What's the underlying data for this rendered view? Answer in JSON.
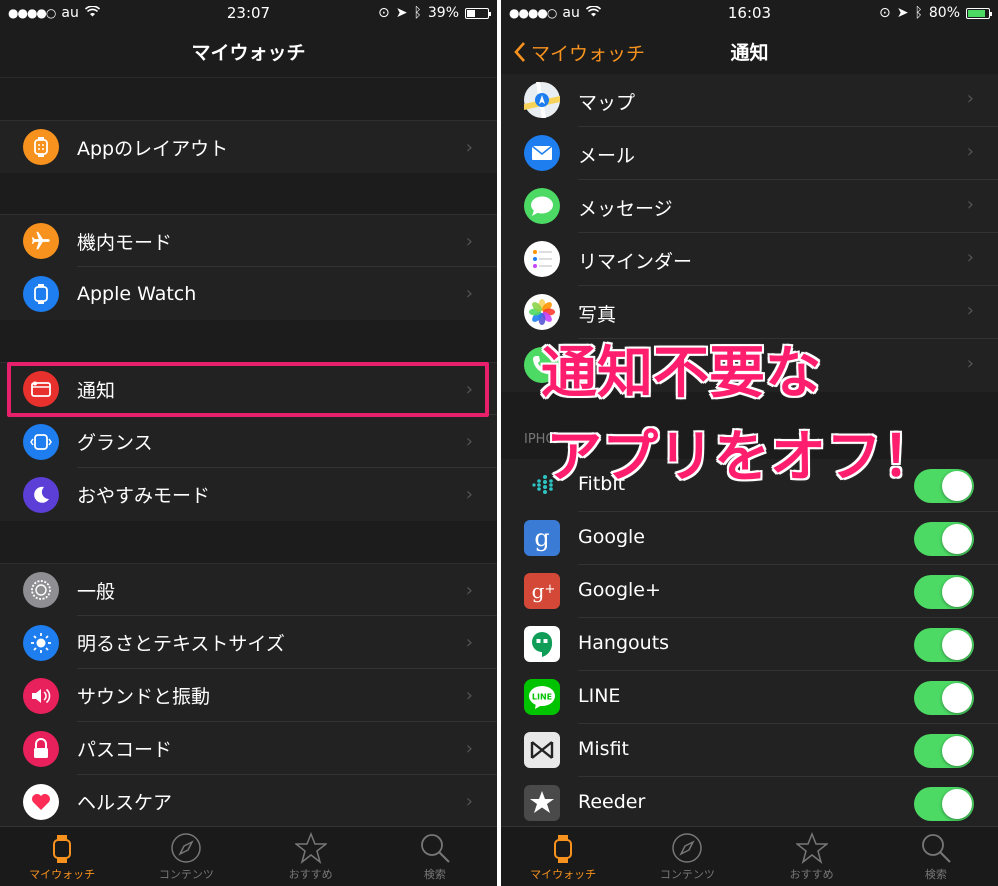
{
  "left": {
    "status": {
      "carrier": "au",
      "time": "23:07",
      "battery": "39%",
      "battery_level": 0.39
    },
    "nav": {
      "title": "マイウォッチ"
    },
    "items": [
      {
        "label": "Appのレイアウト",
        "icon": "app-layout-icon",
        "color": "#f7921e"
      },
      {
        "label": "機内モード",
        "icon": "airplane-icon",
        "color": "#f7921e"
      },
      {
        "label": "Apple Watch",
        "icon": "watch-icon",
        "color": "#1e7ef0"
      },
      {
        "label": "通知",
        "icon": "notification-icon",
        "color": "#e8302c"
      },
      {
        "label": "グランス",
        "icon": "glance-icon",
        "color": "#1e7ef0"
      },
      {
        "label": "おやすみモード",
        "icon": "moon-icon",
        "color": "#5b3fd6"
      },
      {
        "label": "一般",
        "icon": "gear-icon",
        "color": "#8e8e93"
      },
      {
        "label": "明るさとテキストサイズ",
        "icon": "sun-icon",
        "color": "#1e7ef0"
      },
      {
        "label": "サウンドと振動",
        "icon": "speaker-icon",
        "color": "#e8205c"
      },
      {
        "label": "パスコード",
        "icon": "lock-icon",
        "color": "#e8205c"
      },
      {
        "label": "ヘルスケア",
        "icon": "heart-icon",
        "color": "#ffffff"
      }
    ],
    "tabs": [
      {
        "label": "マイウォッチ",
        "icon": "watch-tab-icon"
      },
      {
        "label": "コンテンツ",
        "icon": "compass-icon"
      },
      {
        "label": "おすすめ",
        "icon": "star-icon"
      },
      {
        "label": "検索",
        "icon": "search-icon"
      }
    ]
  },
  "right": {
    "status": {
      "carrier": "au",
      "time": "16:03",
      "battery": "80%",
      "battery_level": 0.8
    },
    "nav": {
      "title": "通知",
      "back_label": "マイウォッチ"
    },
    "mirror_items": [
      {
        "label": "マップ",
        "icon": "maps-icon"
      },
      {
        "label": "メール",
        "icon": "mail-icon"
      },
      {
        "label": "メッセージ",
        "icon": "messages-icon"
      },
      {
        "label": "リマインダー",
        "icon": "reminders-icon"
      },
      {
        "label": "写真",
        "icon": "photos-icon"
      },
      {
        "label": "",
        "icon": "phone-icon"
      }
    ],
    "section_header": "IPHO",
    "toggle_items": [
      {
        "label": "Fitbit",
        "icon": "fitbit-icon",
        "on": true
      },
      {
        "label": "Google",
        "icon": "google-icon",
        "on": true
      },
      {
        "label": "Google+",
        "icon": "google-plus-icon",
        "on": true
      },
      {
        "label": "Hangouts",
        "icon": "hangouts-icon",
        "on": true
      },
      {
        "label": "LINE",
        "icon": "line-icon",
        "on": true
      },
      {
        "label": "Misfit",
        "icon": "misfit-icon",
        "on": true
      },
      {
        "label": "Reeder",
        "icon": "reeder-icon",
        "on": true
      }
    ],
    "overlay": {
      "line1": "通知不要な",
      "line2": "アプリをオフ！"
    },
    "tabs": [
      {
        "label": "マイウォッチ",
        "icon": "watch-tab-icon"
      },
      {
        "label": "コンテンツ",
        "icon": "compass-icon"
      },
      {
        "label": "おすすめ",
        "icon": "star-icon"
      },
      {
        "label": "検索",
        "icon": "search-icon"
      }
    ]
  }
}
